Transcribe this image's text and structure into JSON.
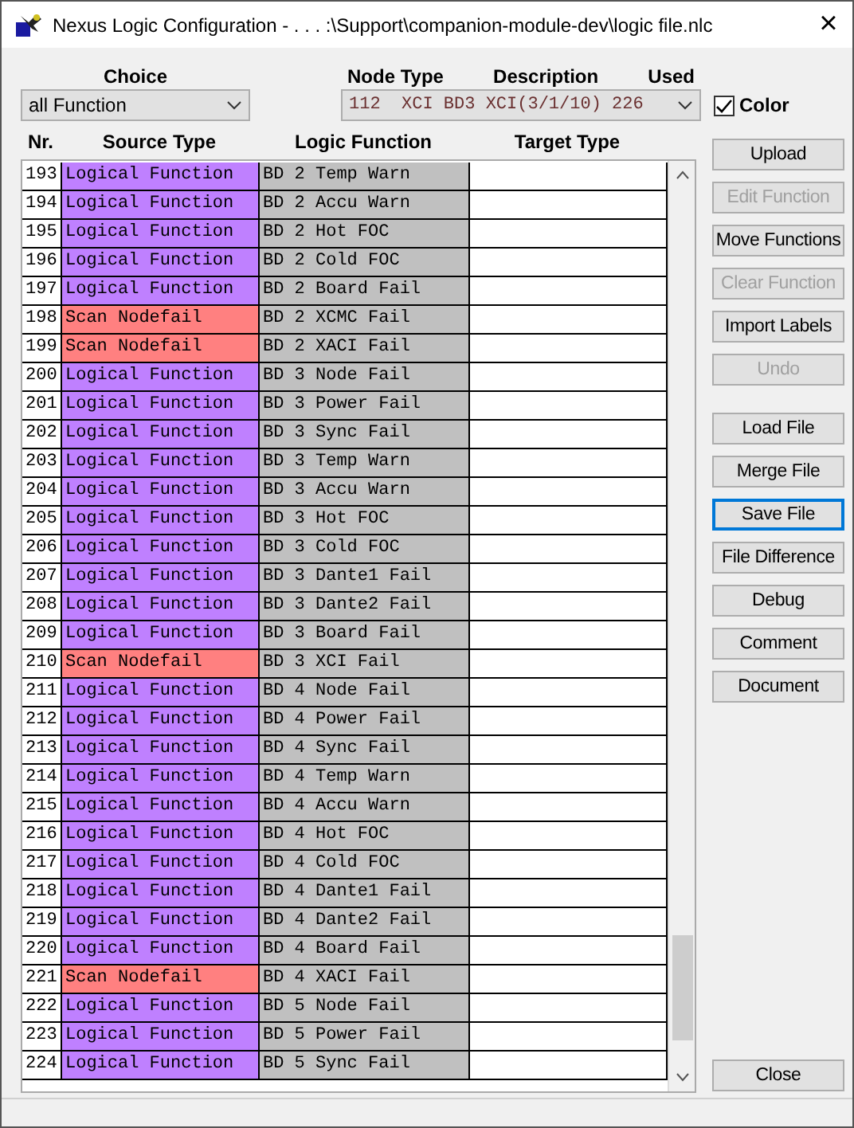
{
  "window": {
    "title": "Nexus Logic Configuration - . . . :\\Support\\companion-module-dev\\logic file.nlc",
    "close": "×"
  },
  "choice": {
    "label": "Choice",
    "value": "all Function"
  },
  "node": {
    "labels": [
      "Node Type",
      "Description",
      "Used"
    ],
    "value": "112  XCI BD3 XCI(3/1/10) 226"
  },
  "color_checkbox": {
    "label": "Color",
    "checked": true
  },
  "table": {
    "columns": [
      "Nr.",
      "Source Type",
      "Logic Function",
      "Target Type"
    ],
    "rows": [
      {
        "nr": "193",
        "source": "Logical Function",
        "color": "#bf80ff",
        "function": "BD 2 Temp Warn"
      },
      {
        "nr": "194",
        "source": "Logical Function",
        "color": "#bf80ff",
        "function": "BD 2 Accu Warn"
      },
      {
        "nr": "195",
        "source": "Logical Function",
        "color": "#bf80ff",
        "function": "BD 2 Hot FOC"
      },
      {
        "nr": "196",
        "source": "Logical Function",
        "color": "#bf80ff",
        "function": "BD 2 Cold FOC"
      },
      {
        "nr": "197",
        "source": "Logical Function",
        "color": "#bf80ff",
        "function": "BD 2 Board Fail"
      },
      {
        "nr": "198",
        "source": "Scan Nodefail",
        "color": "#ff8080",
        "function": "BD 2 XCMC Fail"
      },
      {
        "nr": "199",
        "source": "Scan Nodefail",
        "color": "#ff8080",
        "function": "BD 2 XACI Fail"
      },
      {
        "nr": "200",
        "source": "Logical Function",
        "color": "#bf80ff",
        "function": "BD 3 Node Fail"
      },
      {
        "nr": "201",
        "source": "Logical Function",
        "color": "#bf80ff",
        "function": "BD 3 Power Fail"
      },
      {
        "nr": "202",
        "source": "Logical Function",
        "color": "#bf80ff",
        "function": "BD 3 Sync Fail"
      },
      {
        "nr": "203",
        "source": "Logical Function",
        "color": "#bf80ff",
        "function": "BD 3 Temp Warn"
      },
      {
        "nr": "204",
        "source": "Logical Function",
        "color": "#bf80ff",
        "function": "BD 3 Accu Warn"
      },
      {
        "nr": "205",
        "source": "Logical Function",
        "color": "#bf80ff",
        "function": "BD 3 Hot FOC"
      },
      {
        "nr": "206",
        "source": "Logical Function",
        "color": "#bf80ff",
        "function": "BD 3 Cold FOC"
      },
      {
        "nr": "207",
        "source": "Logical Function",
        "color": "#bf80ff",
        "function": "BD 3 Dante1 Fail"
      },
      {
        "nr": "208",
        "source": "Logical Function",
        "color": "#bf80ff",
        "function": "BD 3 Dante2 Fail"
      },
      {
        "nr": "209",
        "source": "Logical Function",
        "color": "#bf80ff",
        "function": "BD 3 Board Fail"
      },
      {
        "nr": "210",
        "source": "Scan Nodefail",
        "color": "#ff8080",
        "function": "BD 3 XCI Fail"
      },
      {
        "nr": "211",
        "source": "Logical Function",
        "color": "#bf80ff",
        "function": "BD 4 Node Fail"
      },
      {
        "nr": "212",
        "source": "Logical Function",
        "color": "#bf80ff",
        "function": "BD 4 Power Fail"
      },
      {
        "nr": "213",
        "source": "Logical Function",
        "color": "#bf80ff",
        "function": "BD 4 Sync Fail"
      },
      {
        "nr": "214",
        "source": "Logical Function",
        "color": "#bf80ff",
        "function": "BD 4 Temp Warn"
      },
      {
        "nr": "215",
        "source": "Logical Function",
        "color": "#bf80ff",
        "function": "BD 4 Accu Warn"
      },
      {
        "nr": "216",
        "source": "Logical Function",
        "color": "#bf80ff",
        "function": "BD 4 Hot FOC"
      },
      {
        "nr": "217",
        "source": "Logical Function",
        "color": "#bf80ff",
        "function": "BD 4 Cold FOC"
      },
      {
        "nr": "218",
        "source": "Logical Function",
        "color": "#bf80ff",
        "function": "BD 4 Dante1 Fail"
      },
      {
        "nr": "219",
        "source": "Logical Function",
        "color": "#bf80ff",
        "function": "BD 4 Dante2 Fail"
      },
      {
        "nr": "220",
        "source": "Logical Function",
        "color": "#bf80ff",
        "function": "BD 4 Board Fail"
      },
      {
        "nr": "221",
        "source": "Scan Nodefail",
        "color": "#ff8080",
        "function": "BD 4 XACI Fail"
      },
      {
        "nr": "222",
        "source": "Logical Function",
        "color": "#bf80ff",
        "function": "BD 5 Node Fail"
      },
      {
        "nr": "223",
        "source": "Logical Function",
        "color": "#bf80ff",
        "function": "BD 5 Power Fail"
      },
      {
        "nr": "224",
        "source": "Logical Function",
        "color": "#bf80ff",
        "function": "BD 5 Sync Fail"
      }
    ]
  },
  "button_groups": [
    [
      {
        "label": "Upload",
        "disabled": false,
        "focused": false
      },
      {
        "label": "Edit Function",
        "disabled": true,
        "focused": false
      },
      {
        "label": "Move Functions",
        "disabled": false,
        "focused": false
      },
      {
        "label": "Clear Function",
        "disabled": true,
        "focused": false
      },
      {
        "label": "Import Labels",
        "disabled": false,
        "focused": false
      },
      {
        "label": "Undo",
        "disabled": true,
        "focused": false
      }
    ],
    [
      {
        "label": "Load File",
        "disabled": false,
        "focused": false
      },
      {
        "label": "Merge File",
        "disabled": false,
        "focused": false
      },
      {
        "label": "Save File",
        "disabled": false,
        "focused": true
      },
      {
        "label": "File Difference",
        "disabled": false,
        "focused": false
      },
      {
        "label": "Debug",
        "disabled": false,
        "focused": false
      },
      {
        "label": "Comment",
        "disabled": false,
        "focused": false
      },
      {
        "label": "Document",
        "disabled": false,
        "focused": false
      }
    ]
  ],
  "close_button": {
    "label": "Close"
  }
}
